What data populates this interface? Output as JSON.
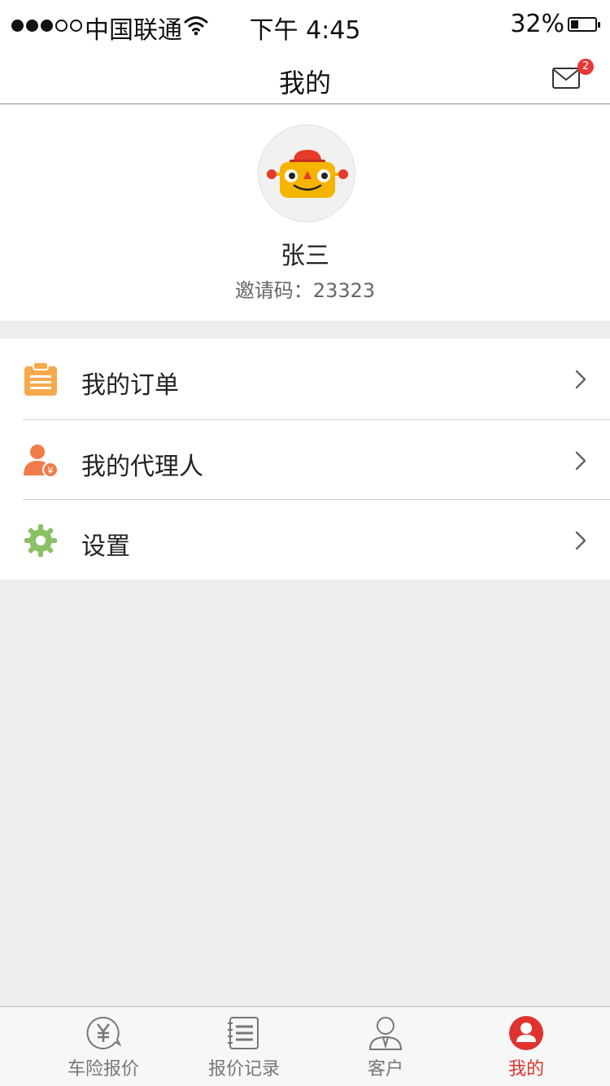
{
  "status_bar": {
    "carrier": "中国联通",
    "time": "下午 4:45",
    "battery_percent": "32%",
    "battery_level": 0.32
  },
  "header": {
    "title": "我的",
    "messages_badge": "2"
  },
  "profile": {
    "name": "张三",
    "invite_code": "邀请码：23323"
  },
  "menu": [
    {
      "label": "我的订单",
      "icon": "clipboard-icon",
      "color": "#f6a94a"
    },
    {
      "label": "我的代理人",
      "icon": "agent-icon",
      "color": "#f07c4a"
    },
    {
      "label": "设置",
      "icon": "gear-icon",
      "color": "#8cc067"
    }
  ],
  "tab_bar": [
    {
      "label": "车险报价",
      "icon": "yuan-quote-icon"
    },
    {
      "label": "报价记录",
      "icon": "records-icon"
    },
    {
      "label": "客户",
      "icon": "customer-icon"
    },
    {
      "label": "我的",
      "icon": "profile-icon",
      "active": true
    }
  ],
  "colors": {
    "accent": "#e0332e",
    "background": "#eeedeb",
    "inactive_tab": "#777777"
  }
}
